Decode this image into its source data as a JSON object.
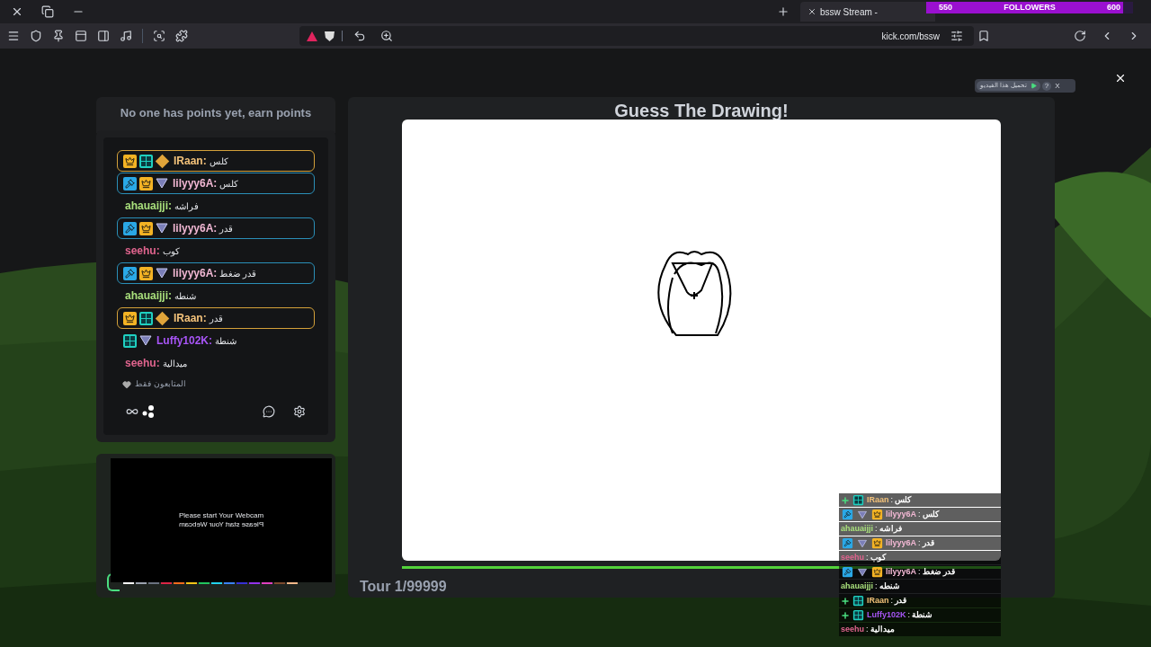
{
  "tab": {
    "title": "bssw Stream -"
  },
  "followers_goal": {
    "start": "550",
    "label": "FOLLOWERS",
    "end": "600",
    "level": 0.95
  },
  "address_bar": {
    "url": "kick.com/bssw"
  },
  "leaderboard": {
    "text": "No one has points yet, earn points"
  },
  "chat": {
    "messages": [
      {
        "kind": "vip",
        "user": "IRaan:",
        "color": "#f3c27a",
        "text": "كلس"
      },
      {
        "kind": "mod",
        "user": "lilyyy6A:",
        "color": "#f2b8d4",
        "text": "كلس"
      },
      {
        "kind": "plain",
        "user": "ahauaijji:",
        "color": "#a9e07c",
        "text": "فراشه"
      },
      {
        "kind": "mod",
        "user": "lilyyy6A:",
        "color": "#f2b8d4",
        "text": "قدر"
      },
      {
        "kind": "plain",
        "user": "seehu:",
        "color": "#e0648e",
        "text": "كوب"
      },
      {
        "kind": "mod",
        "user": "lilyyy6A:",
        "color": "#f2b8d4",
        "text": "قدر ضغط"
      },
      {
        "kind": "plain",
        "user": "ahauaijji:",
        "color": "#a9e07c",
        "text": "شنطه"
      },
      {
        "kind": "vip",
        "user": "IRaan:",
        "color": "#f3c27a",
        "text": "قدر"
      },
      {
        "kind": "sub",
        "user": "Luffy102K:",
        "color": "#a855f7",
        "text": "شنطة"
      },
      {
        "kind": "plain",
        "user": "seehu:",
        "color": "#e0648e",
        "text": "ميدالية"
      }
    ],
    "followers_only": "المتابعون فقط"
  },
  "webcam": {
    "lines": [
      {
        "text": "Please start Your Webcam",
        "mirrored": false
      },
      {
        "text": "Please start Your Webcam",
        "mirrored": true
      }
    ]
  },
  "palette": [
    {
      "color": "#ffffff"
    },
    {
      "color": "#9ca3af"
    },
    {
      "color": "#6b7280"
    },
    {
      "color": "#dc2646"
    },
    {
      "color": "#f26b1d"
    },
    {
      "color": "#f5c518"
    },
    {
      "color": "#22c55e"
    },
    {
      "color": "#22d3ee"
    },
    {
      "color": "#3b82f6"
    },
    {
      "color": "#3730d4"
    },
    {
      "color": "#9333ea"
    },
    {
      "color": "#e040c0"
    },
    {
      "color": "#7c4a2d"
    },
    {
      "color": "#f4b88a"
    }
  ],
  "game": {
    "title": "Guess The Drawing!",
    "round": "Tour 1/99999",
    "timer": {
      "level": 1
    }
  },
  "overlay_chat": {
    "messages": [
      {
        "kind": "vip",
        "user": "IRaan",
        "color": "#f3c27a",
        "separator": ":",
        "text": "كلس"
      },
      {
        "kind": "mod",
        "user": "lilyyy6A",
        "color": "#f2b8d4",
        "separator": ":",
        "text": "كلس"
      },
      {
        "kind": "plain",
        "user": "ahauaijji",
        "color": "#a9e07c",
        "separator": ":",
        "text": "فراشه"
      },
      {
        "kind": "mod",
        "user": "lilyyy6A",
        "color": "#f2b8d4",
        "separator": ":",
        "text": "قدر"
      },
      {
        "kind": "plain",
        "user": "seehu",
        "color": "#e0648e",
        "separator": ":",
        "text": "كوب"
      },
      {
        "kind": "mod",
        "user": "lilyyy6A",
        "color": "#f2b8d4",
        "separator": ":",
        "text": "قدر ضغط"
      },
      {
        "kind": "plain",
        "user": "ahauaijji",
        "color": "#a9e07c",
        "separator": ":",
        "text": "شنطه"
      },
      {
        "kind": "vip",
        "user": "IRaan",
        "color": "#f3c27a",
        "separator": ":",
        "text": "قدر"
      },
      {
        "kind": "sub",
        "user": "Luffy102K",
        "color": "#a855f7",
        "separator": ":",
        "text": "شنطة"
      },
      {
        "kind": "plain",
        "user": "seehu",
        "color": "#e0648e",
        "separator": ":",
        "text": "ميدالية"
      }
    ]
  },
  "download_ad": {
    "label": "تحميل هذا الفيديو",
    "help": "?",
    "close": "X"
  }
}
